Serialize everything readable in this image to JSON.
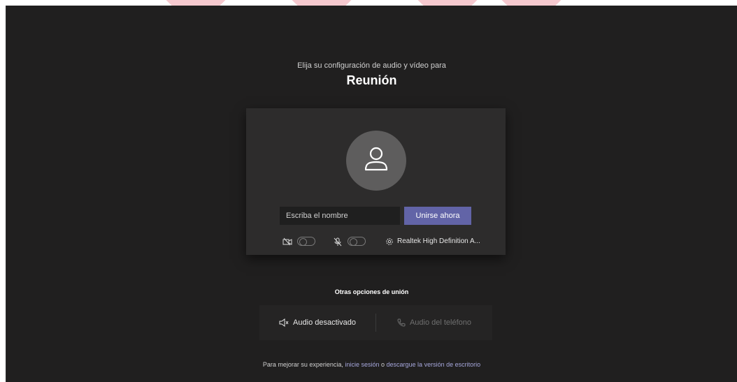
{
  "header": {
    "subtitle": "Elija su configuración de audio y vídeo para",
    "title": "Reunión"
  },
  "prejoin": {
    "name_placeholder": "Escriba el nombre",
    "join_label": "Unirse ahora",
    "camera_toggle_on": false,
    "mic_toggle_on": false,
    "device_label": "Realtek High Definition A...",
    "accent_color": "#6264a7"
  },
  "other_options": {
    "title": "Otras opciones de unión",
    "audio_off_label": "Audio desactivado",
    "phone_audio_label": "Audio del teléfono"
  },
  "footer": {
    "prefix": "Para mejorar su experiencia,",
    "sign_in_link": "inicie sesión",
    "connector": "o",
    "download_link": "descargue la versión de escritorio"
  },
  "icons": [
    "person-icon",
    "camera-off-icon",
    "mic-off-icon",
    "gear-icon",
    "speaker-off-icon",
    "phone-icon"
  ]
}
